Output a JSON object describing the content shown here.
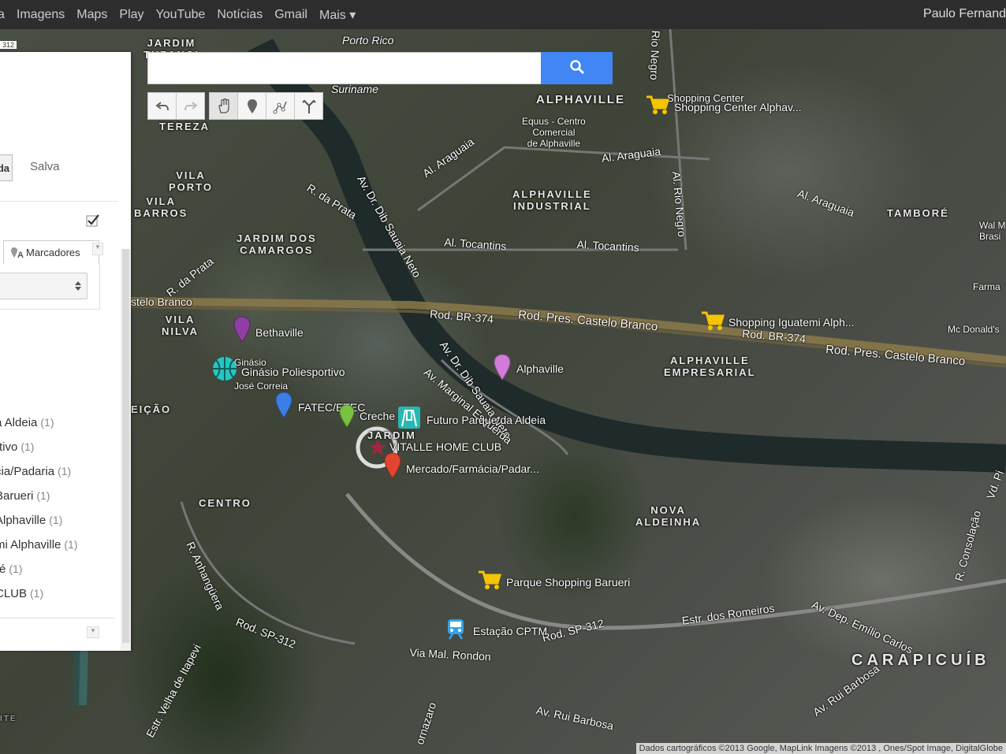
{
  "topbar": {
    "items": [
      "a",
      "Imagens",
      "Maps",
      "Play",
      "YouTube",
      "Notícias",
      "Gmail",
      "Mais ▾"
    ],
    "user": "Paulo Fernand"
  },
  "search": {
    "value": ""
  },
  "panel": {
    "btn_label": "da",
    "save_label": "Salva",
    "tab_label": "Marcadores",
    "categories": [
      {
        "name": ")",
        "count": ""
      },
      {
        "name": "a Aldeia",
        "count": "(1)"
      },
      {
        "name": "rtivo",
        "count": "(1)"
      },
      {
        "name": "cia/Padaria",
        "count": "(1)"
      },
      {
        "name": " Barueri",
        "count": "(1)"
      },
      {
        "name": " Alphaville",
        "count": "(1)"
      },
      {
        "name": "mi Alphaville",
        "count": "(1)"
      },
      {
        "name": "ré",
        "count": "(1)"
      },
      {
        "name": "CLUB",
        "count": "(1)"
      }
    ]
  },
  "map": {
    "small_badge": "312",
    "districts": [
      "JARDIM\nTUPANCI",
      "TEREZA",
      "VILA\nPORTO",
      "VILA\nBARROS",
      "JARDIM DOS\nCAMARGOS",
      "ALPHAVILLE",
      "ALPHAVILLE\nINDUSTRIAL",
      "TAMBORÉ",
      "VILA\nNILVA",
      "ALPHAVILLE\nEMPRESARIAL",
      "JARDIM",
      "CENTRO",
      "NOVA\nALDEINHA",
      "CARAPICUÍB",
      "EIÇÃO",
      "ITE"
    ],
    "roads": [
      "Porto Rico",
      "Suriname",
      "R. da Prata",
      "Av. Dr. Dib Sauaia Neto",
      "Al. Araguaia",
      "Al. Araguaia",
      "Al. Tocantins",
      "Al. Tocantins",
      "Al. Rio Negro",
      "Al. Rio Negro",
      "Al. Araguaia",
      "R. da Prata",
      "stelo Branco",
      "Rod. BR-374",
      "Rod. Pres. Castelo Branco",
      "Rod. BR-374",
      "Rod. Pres. Castelo Branco",
      "Av. Dr. Dib Sauaia Neto",
      "Av. Marginal Esquerda",
      "R. Anhangüera",
      "Rod. SP-312",
      "Rod. SP-312",
      "Via Mal. Rondon",
      "Estr. dos Romeiros",
      "Av. Dep. Emílio Carlos",
      "R. Consolação",
      "Av. Rui Barbosa",
      "Av. Rui Barbosa",
      "Estr. Velha de Itapevi",
      "Vd. Pi",
      "ornazaro",
      "Equus - Centro\nComercial\nde Alphaville",
      "Wal M\nBrasi",
      "Farma",
      "Mc Donald's",
      "Ginásio\nJosé Correia",
      "Shopping Center",
      "Rio Negro",
      "Al. Rio Negro"
    ],
    "places": [
      "Shopping Center Alphav...",
      "Shopping Iguatemi Alph...",
      "Bethaville",
      "Ginásio Poliesportivo",
      "Alphaville",
      "FATEC/ETEC",
      "Creche",
      "Futuro Parque da Aldeia",
      "VITALLE HOME CLUB",
      "Mercado/Farmácia/Padar...",
      "Parque Shopping Barueri",
      "Estação CPTM"
    ],
    "copyright": "Dados cartográficos ©2013 Google, MapLink Imagens ©2013 , Ones/Spot Image, DigitalGlobe"
  }
}
